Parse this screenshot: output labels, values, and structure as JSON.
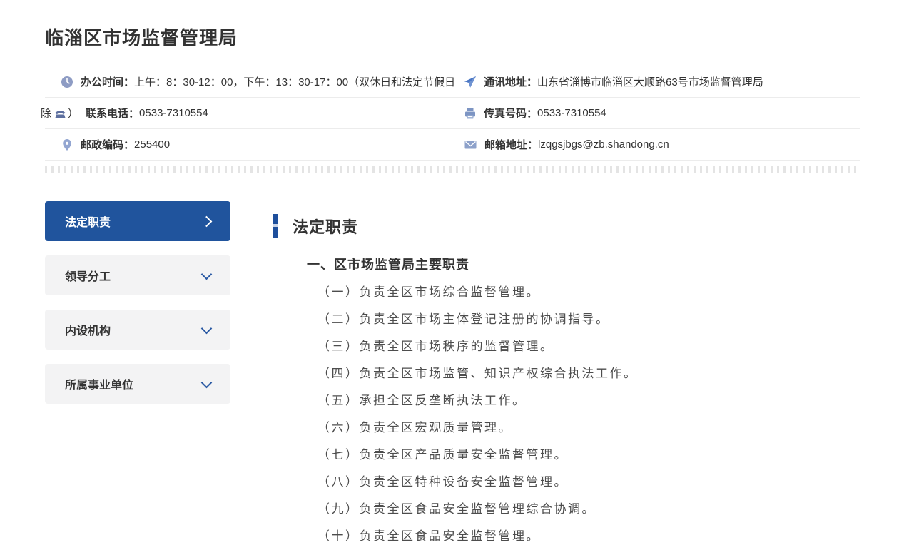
{
  "page": {
    "title": "临淄区市场监督管理局"
  },
  "info": {
    "rows": [
      {
        "icon": "clock-icon",
        "label": "办公时间：",
        "value": "上午：8：30-12：00，下午：13：30-17：00（双休日和法定节假日"
      },
      {
        "icon": "send-icon",
        "label": "通讯地址：",
        "value": "山东省淄博市临淄区大顺路63号市场监督管理局"
      },
      {
        "prefix": "除",
        "prefix_close": "）",
        "icon": "phone-icon",
        "label": "联系电话：",
        "value": "0533-7310554"
      },
      {
        "icon": "fax-icon",
        "label": "传真号码：",
        "value": "0533-7310554"
      },
      {
        "icon": "location-pin-icon",
        "label": "邮政编码：",
        "value": "255400"
      },
      {
        "icon": "mail-icon",
        "label": "邮箱地址：",
        "value": "lzqgsjbgs@zb.shandong.cn"
      }
    ]
  },
  "sidebar": {
    "items": [
      {
        "label": "法定职责",
        "active": true
      },
      {
        "label": "领导分工",
        "active": false
      },
      {
        "label": "内设机构",
        "active": false
      },
      {
        "label": "所属事业单位",
        "active": false
      }
    ]
  },
  "main": {
    "heading": "法定职责",
    "subheading": "一、区市场监管局主要职责",
    "duties": [
      "（一）负责全区市场综合监督管理。",
      "（二）负责全区市场主体登记注册的协调指导。",
      "（三）负责全区市场秩序的监督管理。",
      "（四）负责全区市场监管、知识产权综合执法工作。",
      "（五）承担全区反垄断执法工作。",
      "（六）负责全区宏观质量管理。",
      "（七）负责全区产品质量安全监督管理。",
      "（八）负责全区特种设备安全监督管理。",
      "（九）负责全区食品安全监督管理综合协调。",
      "（十）负责全区食品安全监督管理。"
    ]
  },
  "colors": {
    "accent_blue": "#20549d",
    "icon_slate": "#8e9cc4",
    "sidebar_inactive_bg": "#f3f3f4",
    "divider": "#ececec",
    "text_dark": "#333333",
    "duty_text": "#4d4d4d"
  }
}
